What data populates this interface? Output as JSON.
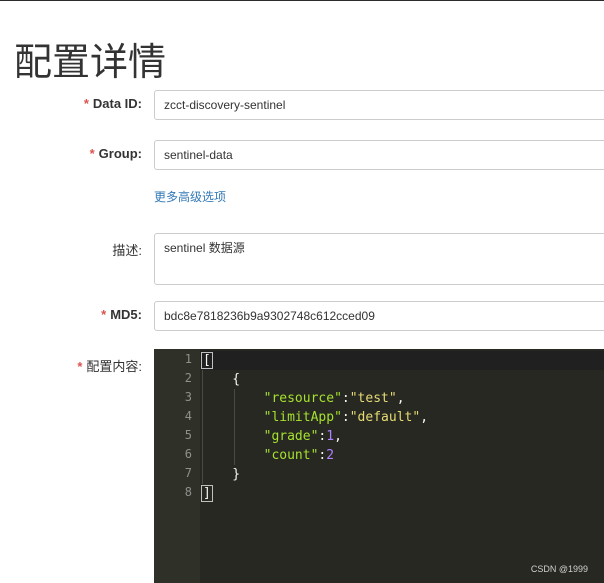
{
  "page": {
    "title": "配置详情"
  },
  "form": {
    "required_mark": "*",
    "data_id": {
      "label": "Data ID:",
      "value": "zcct-discovery-sentinel"
    },
    "group": {
      "label": "Group:",
      "value": "sentinel-data"
    },
    "advanced_link": "更多高级选项",
    "description": {
      "label": "描述:",
      "value": "sentinel 数据源"
    },
    "md5": {
      "label": "MD5:",
      "value": "bdc8e7818236b9a9302748c612cced09"
    },
    "content": {
      "label": "配置内容:"
    }
  },
  "editor": {
    "line_numbers": [
      "1",
      "2",
      "3",
      "4",
      "5",
      "6",
      "7",
      "8"
    ],
    "lines": [
      {
        "text": "["
      },
      {
        "text": "    {"
      },
      {
        "indent": "        ",
        "key": "\"resource\"",
        "sep": ":",
        "val": "\"test\"",
        "val_type": "str",
        "end": ","
      },
      {
        "indent": "        ",
        "key": "\"limitApp\"",
        "sep": ":",
        "val": "\"default\"",
        "val_type": "str",
        "end": ","
      },
      {
        "indent": "        ",
        "key": "\"grade\"",
        "sep": ":",
        "val": "1",
        "val_type": "num",
        "end": ","
      },
      {
        "indent": "        ",
        "key": "\"count\"",
        "sep": ":",
        "val": "2",
        "val_type": "num",
        "end": ""
      },
      {
        "text": "    }"
      },
      {
        "text": "]"
      }
    ]
  },
  "watermark": "CSDN @1999"
}
